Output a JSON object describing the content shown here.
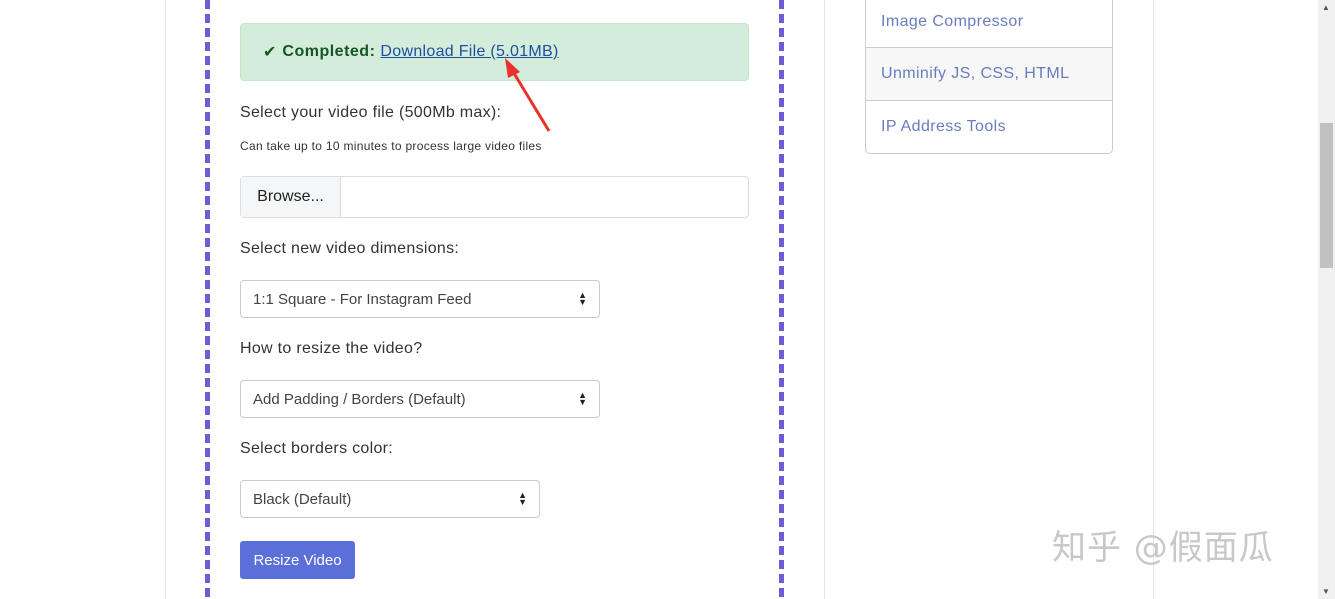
{
  "alert": {
    "status": "Completed:",
    "link": "Download File (5.01MB)"
  },
  "form": {
    "file_label": "Select your video file (500Mb max):",
    "file_hint": "Can take up to 10 minutes to process large video files",
    "browse": "Browse...",
    "dim_label": "Select new video dimensions:",
    "dim_value": "1:1 Square - For Instagram Feed",
    "resize_label": "How to resize the video?",
    "resize_value": "Add Padding / Borders (Default)",
    "color_label": "Select borders color:",
    "color_value": "Black (Default)",
    "submit": "Resize Video"
  },
  "sidebar": {
    "items": [
      {
        "label": "Image Compressor"
      },
      {
        "label": "Unminify JS, CSS, HTML"
      },
      {
        "label": "IP Address Tools"
      }
    ]
  },
  "watermark": "知乎 @假面瓜",
  "colors": {
    "dashed_border": "#6f5bd6",
    "button": "#5a6fd8",
    "alert_bg": "#d4edda",
    "annotation_arrow": "#e8322b"
  }
}
